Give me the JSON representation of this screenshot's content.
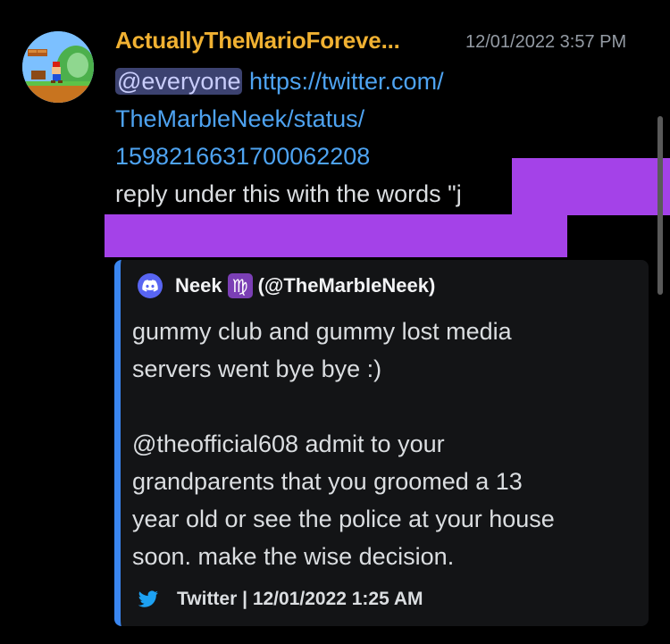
{
  "message": {
    "username": "ActuallyTheMarioForeve...",
    "timestamp": "12/01/2022 3:57 PM",
    "mention": "@everyone",
    "link_lines": [
      "https://twitter.com/",
      "TheMarbleNeek/status/",
      "1598216631700062208"
    ],
    "text_line": "reply under this with the words \"j"
  },
  "embed": {
    "author_name": "Neek",
    "author_emoji": "♍",
    "author_handle": "(@TheMarbleNeek)",
    "description_lines": [
      "gummy club and gummy lost media",
      "servers went bye bye :)",
      "",
      "@theofficial608 admit to your",
      "grandparents that you groomed a 13",
      "year old or see the police at your house",
      "soon. make the wise decision."
    ],
    "footer": "Twitter | 12/01/2022 1:25 AM"
  },
  "colors": {
    "username": "#f0b132",
    "link": "#4ea3f1",
    "mention_bg": "#3c4270",
    "redaction": "#a442e8",
    "embed_border": "#3a86f0"
  },
  "icons": {
    "avatar": "mario-avatar",
    "author": "discord-icon",
    "footer": "twitter-icon"
  }
}
